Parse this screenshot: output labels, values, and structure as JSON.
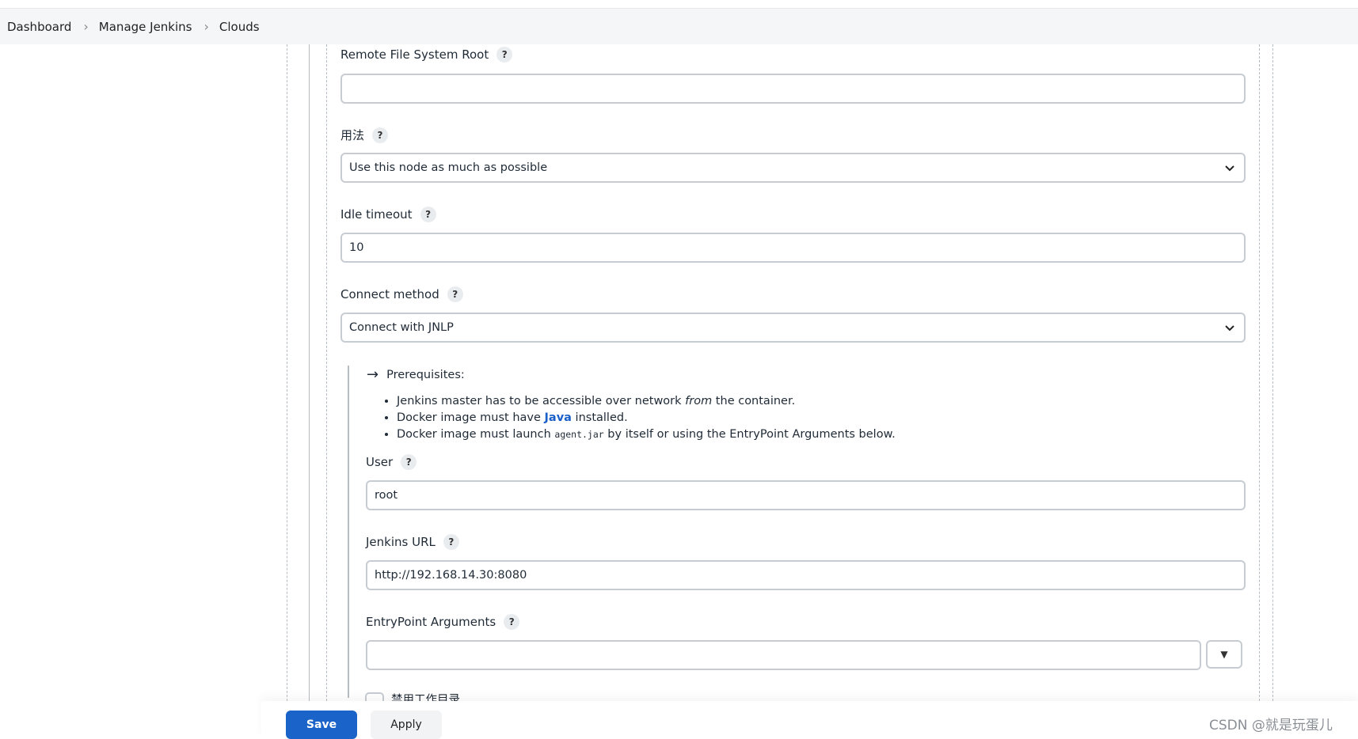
{
  "breadcrumb": [
    "Dashboard",
    "Manage Jenkins",
    "Clouds"
  ],
  "fields": {
    "remote_fs_root": {
      "label": "Remote File System Root",
      "value": ""
    },
    "usage": {
      "label": "用法",
      "value": "Use this node as much as possible"
    },
    "idle_timeout": {
      "label": "Idle timeout",
      "value": "10"
    },
    "connect_method": {
      "label": "Connect method",
      "value": "Connect with JNLP"
    },
    "user": {
      "label": "User",
      "value": "root"
    },
    "jenkins_url": {
      "label": "Jenkins URL",
      "value": "http://192.168.14.30:8080"
    },
    "entrypoint_args": {
      "label": "EntryPoint Arguments",
      "value": ""
    },
    "disable_workdir": {
      "label": "禁用工作目录"
    }
  },
  "help_glyph": "?",
  "prereq": {
    "title": "Prerequisites:",
    "item1_pre": "Jenkins master has to be accessible over network ",
    "item1_em": "from",
    "item1_post": " the container.",
    "item2_pre": "Docker image must have ",
    "item2_link": "Java",
    "item2_post": " installed.",
    "item3_pre": "Docker image must launch ",
    "item3_code": "agent.jar",
    "item3_post": " by itself or using the EntryPoint Arguments below."
  },
  "buttons": {
    "save": "Save",
    "apply": "Apply"
  },
  "watermark": "CSDN @就是玩蛋儿",
  "colors": {
    "primary": "#1a63c9",
    "link": "#1b60c9"
  }
}
